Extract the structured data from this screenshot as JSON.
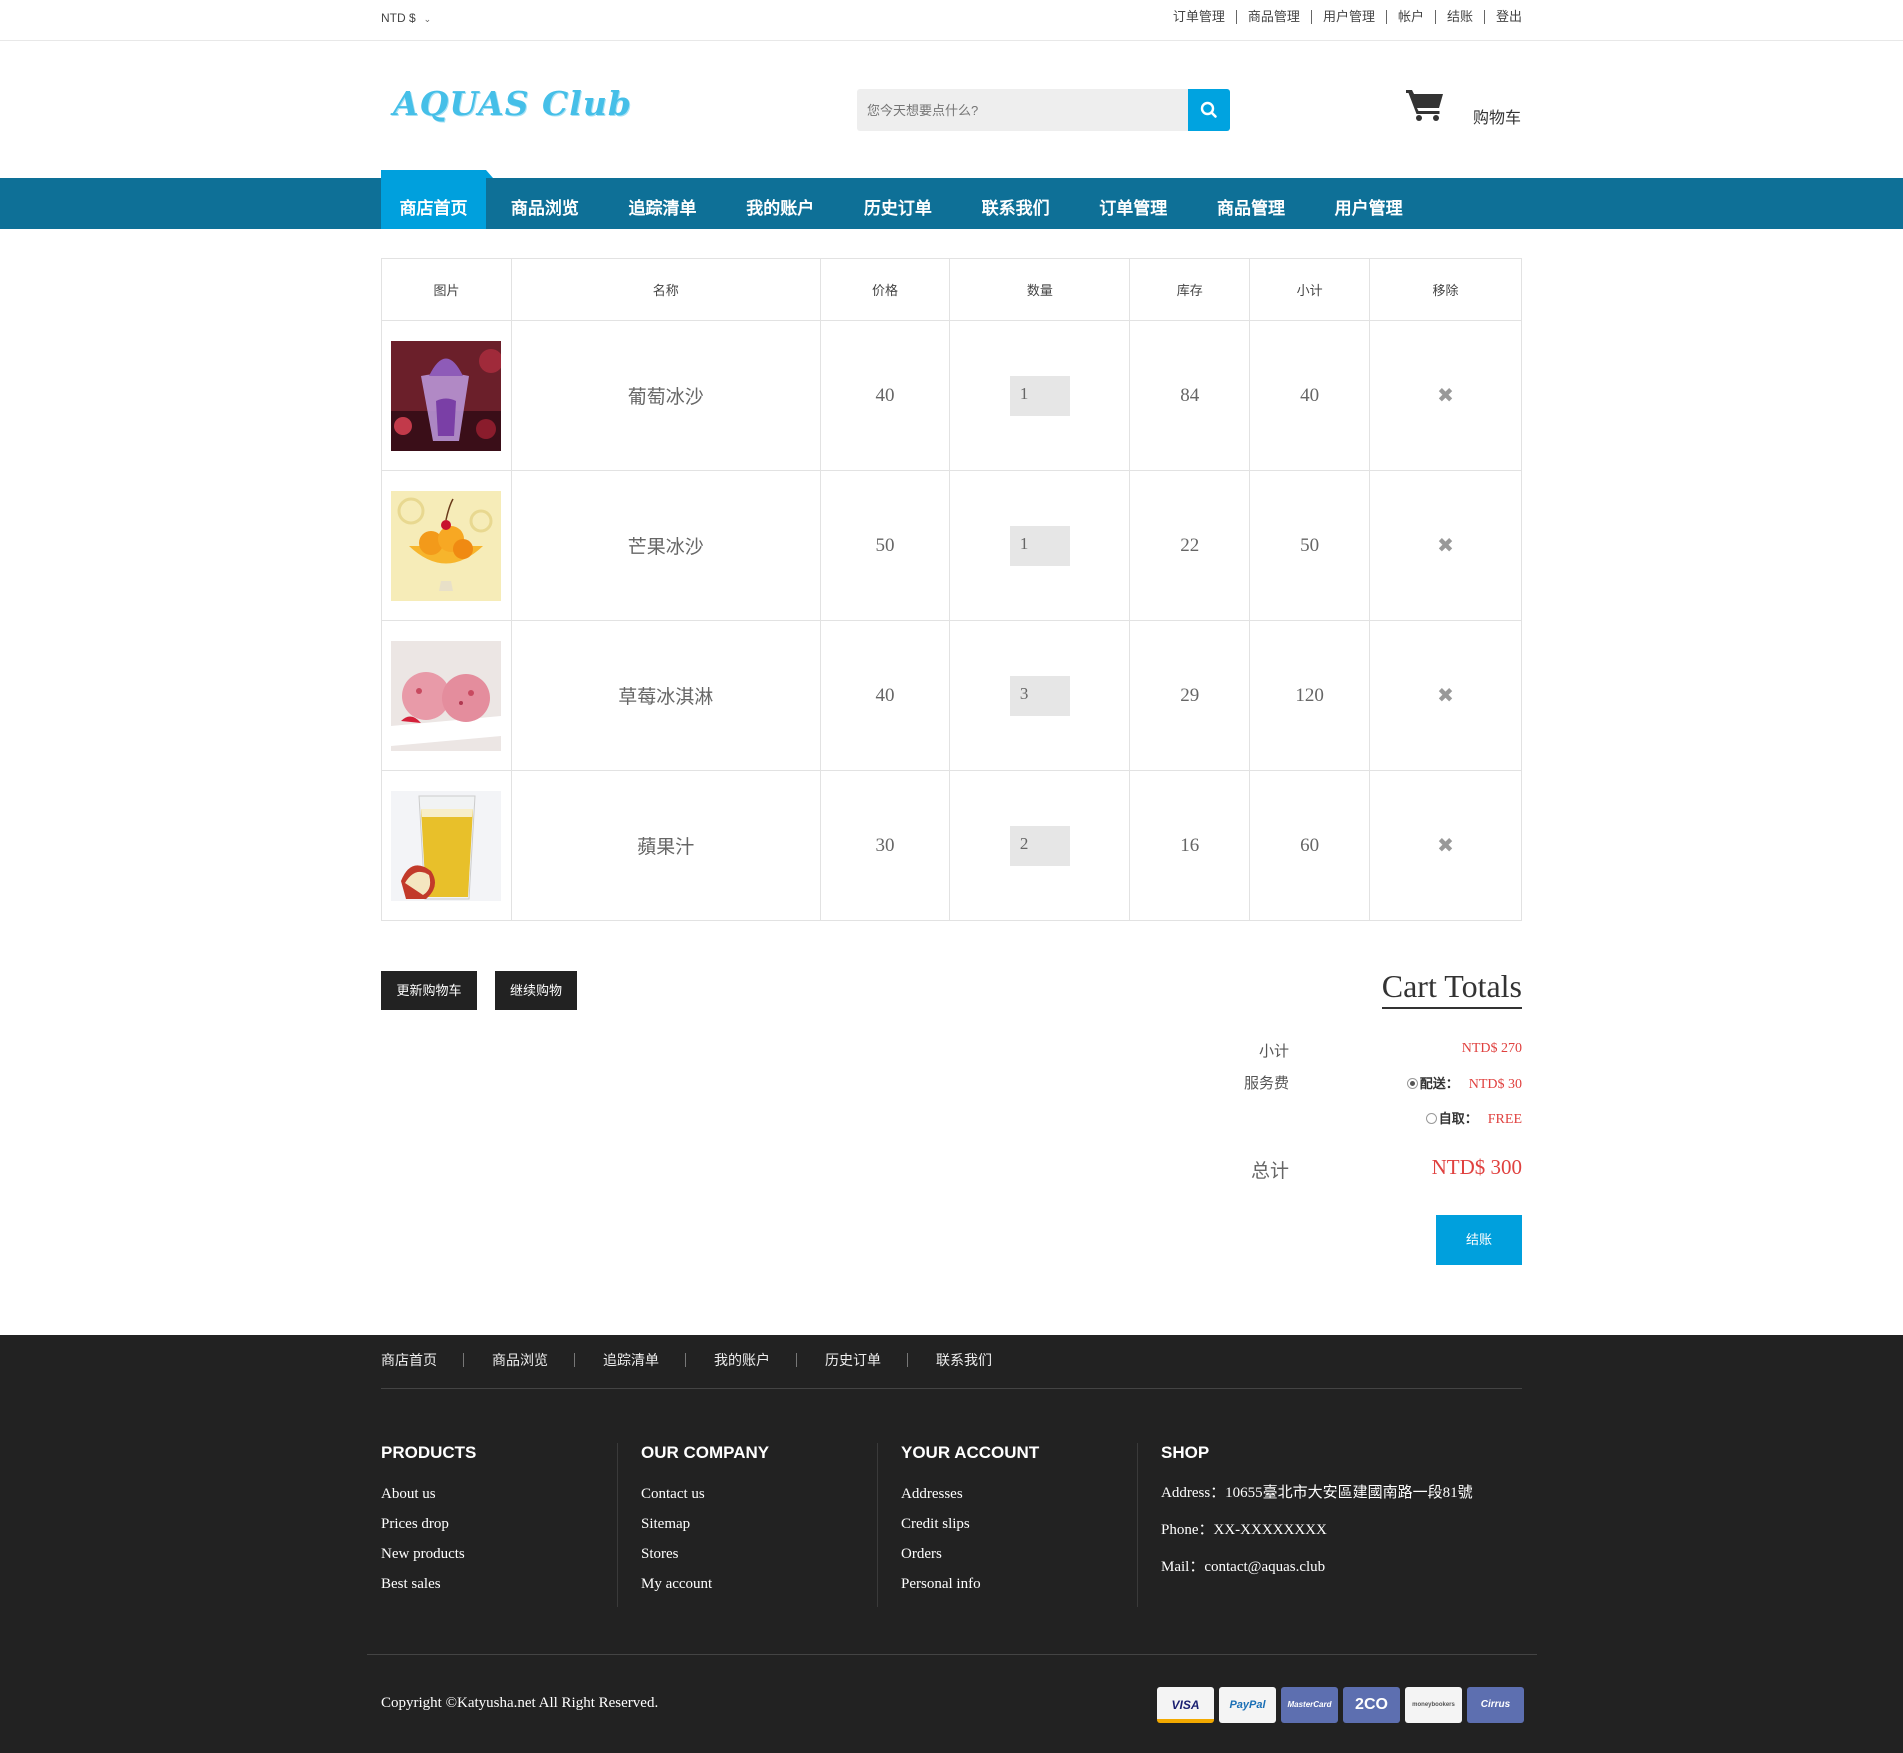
{
  "topbar": {
    "currency": "NTD $",
    "links": [
      "订单管理",
      "商品管理",
      "用户管理",
      "帐户",
      "结账",
      "登出"
    ]
  },
  "header": {
    "logo": "AQUAS Club",
    "search_placeholder": "您今天想要点什么?",
    "cart_label": "购物车"
  },
  "nav": {
    "items": [
      "商店首页",
      "商品浏览",
      "追踪清单",
      "我的账户",
      "历史订单",
      "联系我们",
      "订单管理",
      "商品管理",
      "用户管理"
    ]
  },
  "table": {
    "headers": [
      "图片",
      "名称",
      "价格",
      "数量",
      "库存",
      "小计",
      "移除"
    ],
    "rows": [
      {
        "name": "葡萄冰沙",
        "price": "40",
        "qty": "1",
        "stock": "84",
        "subtotal": "40",
        "image": "grape-smoothie"
      },
      {
        "name": "芒果冰沙",
        "price": "50",
        "qty": "1",
        "stock": "22",
        "subtotal": "50",
        "image": "mango-smoothie"
      },
      {
        "name": "草莓冰淇淋",
        "price": "40",
        "qty": "3",
        "stock": "29",
        "subtotal": "120",
        "image": "strawberry-ice-cream"
      },
      {
        "name": "蘋果汁",
        "price": "30",
        "qty": "2",
        "stock": "16",
        "subtotal": "60",
        "image": "apple-juice"
      }
    ],
    "remove_icon": "close-icon"
  },
  "actions": {
    "update_cart": "更新购物车",
    "continue_shopping": "继续购物"
  },
  "totals": {
    "title": "Cart Totals",
    "subtotal_label": "小计",
    "subtotal_value": "NTD$ 270",
    "service_label": "服务费",
    "delivery_label": "配送：",
    "delivery_value": "NTD$ 30",
    "pickup_label": "自取：",
    "pickup_value": "FREE",
    "total_label": "总计",
    "total_value": "NTD$ 300",
    "checkout": "结账"
  },
  "footer": {
    "nav": [
      "商店首页",
      "商品浏览",
      "追踪清单",
      "我的账户",
      "历史订单",
      "联系我们"
    ],
    "columns": [
      {
        "title": "PRODUCTS",
        "links": [
          "About us",
          "Prices drop",
          "New products",
          "Best sales"
        ]
      },
      {
        "title": "OUR COMPANY",
        "links": [
          "Contact us",
          "Sitemap",
          "Stores",
          "My account"
        ]
      },
      {
        "title": "YOUR ACCOUNT",
        "links": [
          "Addresses",
          "Credit slips",
          "Orders",
          "Personal info"
        ]
      }
    ],
    "shop": {
      "title": "SHOP",
      "address": "Address：10655臺北市大安區建國南路一段81號",
      "phone": "Phone：XX-XXXXXXXX",
      "mail": "Mail：contact@aquas.club"
    },
    "copyright": "Copyright ©Katyusha.net All Right Reserved.",
    "payments": [
      "VISA",
      "PayPal",
      "MasterCard",
      "2CO",
      "moneybookers",
      "Cirrus"
    ]
  },
  "colors": {
    "nav_bg": "#0e7097",
    "accent": "#00a0dd",
    "price_red": "#e0413f",
    "footer_bg": "#222222"
  }
}
